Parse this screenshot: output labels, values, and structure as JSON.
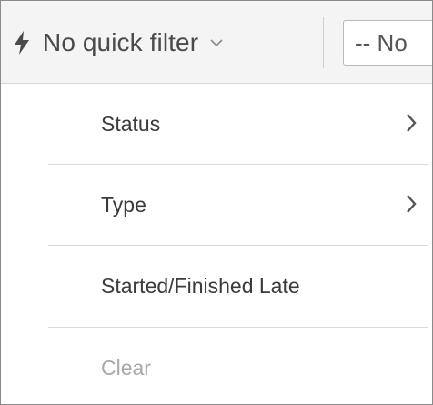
{
  "toolbar": {
    "quick_filter_label": "No quick filter",
    "bolt_icon": "lightning-bolt-icon",
    "dropdown_icon": "chevron-down-icon",
    "select_value": "-- No"
  },
  "menu": {
    "items": [
      {
        "label": "Status",
        "has_submenu": true,
        "disabled": false
      },
      {
        "label": "Type",
        "has_submenu": true,
        "disabled": false
      },
      {
        "label": "Started/Finished Late",
        "has_submenu": false,
        "disabled": false
      },
      {
        "label": "Clear",
        "has_submenu": false,
        "disabled": true
      }
    ]
  },
  "colors": {
    "text": "#3b3b3b",
    "disabled_text": "#a8a8a8",
    "toolbar_bg": "#f4f4f4",
    "separator": "#d9d9d9"
  }
}
